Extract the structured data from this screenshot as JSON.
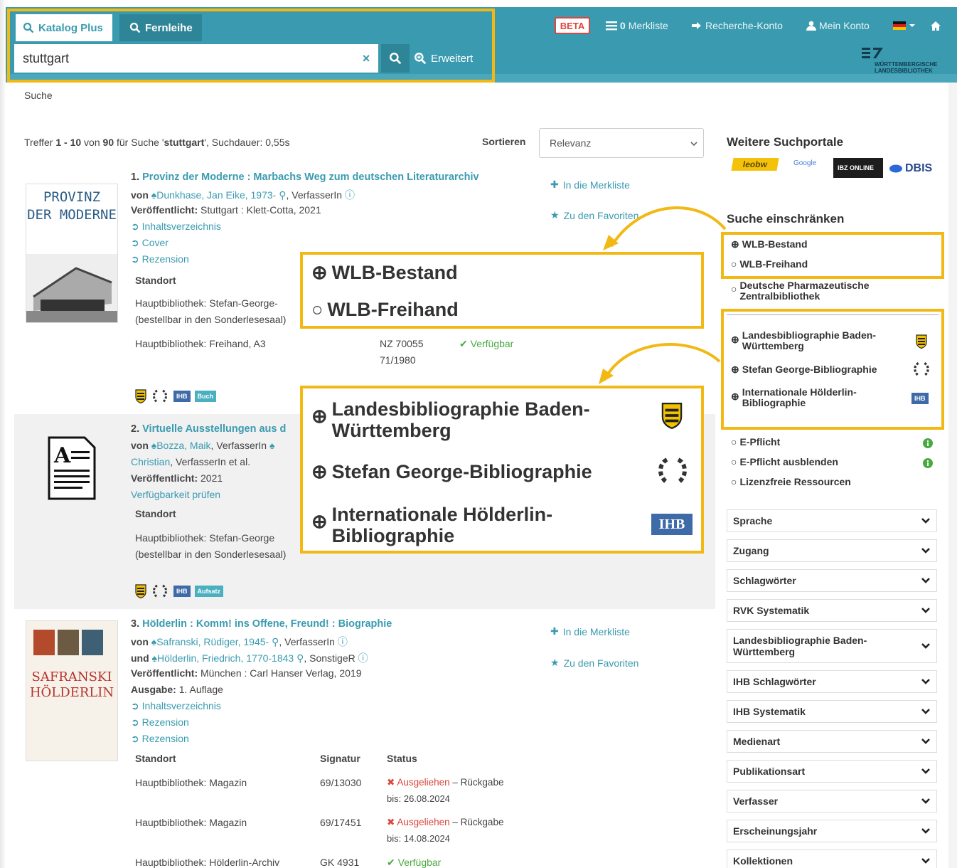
{
  "header": {
    "tab_catalog": "Katalog Plus",
    "tab_ill": "Fernleihe",
    "search_value": "stuttgart",
    "clear_label": "×",
    "advanced_label": "Erweitert",
    "beta": "BETA",
    "watchlist_count": "0",
    "watchlist": "Merkliste",
    "research_account": "Recherche-Konto",
    "my_account": "Mein Konto",
    "logo_line1": "WÜRTTEMBERGISCHE",
    "logo_line2": "LANDESBIBLIOTHEK"
  },
  "breadcrumb": "Suche",
  "results_info": {
    "prefix": "Treffer ",
    "range": "1 - 10",
    "mid": " von ",
    "total": "90",
    "for": " für Suche '",
    "query": "stuttgart",
    "suffix": "', Suchdauer: 0,55s"
  },
  "sort": {
    "label": "Sortieren",
    "value": "Relevanz"
  },
  "result_actions": {
    "add_watchlist": "In die Merkliste",
    "add_favorites": "Zu den Favoriten"
  },
  "results": [
    {
      "num": "1.",
      "title": "Provinz der Moderne : Marbachs Weg zum deutschen Literaturarchiv",
      "by_label": "von",
      "author": "Dunkhase, Jan Eike, 1973-",
      "author_role": ", VerfasserIn",
      "pub_label": "Veröffentlicht:",
      "published": "Stuttgart : Klett-Cotta, 2021",
      "links": [
        "Inhaltsverzeichnis",
        "Cover",
        "Rezension"
      ],
      "loc_header": "Standort",
      "locations": [
        {
          "loc": "Hauptbibliothek: Stefan-George-",
          "loc2": "(bestellbar in den Sonderlesesaal)"
        },
        {
          "loc": "Hauptbibliothek: Freihand, A3",
          "sig": "NZ 70055",
          "sig2": "71/1980",
          "status": "Verfügbar"
        }
      ],
      "badge_ihb": "IHB",
      "badge_type": "Buch",
      "cover_line1": "PROVINZ",
      "cover_line2": "DER MODERNE"
    },
    {
      "num": "2.",
      "title": "Virtuelle Ausstellungen aus d",
      "by_label": "von",
      "author": "Bozza, Maik",
      "author_role": ", VerfasserIn",
      "author_cont": "Christian",
      "author_role2": ", VerfasserIn et al.",
      "pub_label": "Veröffentlicht:",
      "published": "2021",
      "availability": "Verfügbarkeit prüfen",
      "loc_header": "Standort",
      "locations": [
        {
          "loc": "Hauptbibliothek: Stefan-George",
          "loc2": "(bestellbar in den Sonderlesesaal)"
        }
      ],
      "badge_ihb": "IHB",
      "badge_type": "Aufsatz"
    },
    {
      "num": "3.",
      "title": "Hölderlin : Komm! ins Offene, Freund! : Biographie",
      "by_label": "von",
      "author": "Safranski, Rüdiger, 1945-",
      "author_role": ", VerfasserIn",
      "and_label": "und",
      "author2": "Hölderlin, Friedrich, 1770-1843",
      "author2_role": ", SonstigeR",
      "pub_label": "Veröffentlicht:",
      "published": "München : Carl Hanser Verlag, 2019",
      "ed_label": "Ausgabe:",
      "edition": "1. Auflage",
      "links": [
        "Inhaltsverzeichnis",
        "Rezension",
        "Rezension"
      ],
      "loc_header": "Standort",
      "sig_header": "Signatur",
      "status_header": "Status",
      "locations": [
        {
          "loc": "Hauptbibliothek: Magazin",
          "sig": "69/13030",
          "status": "Ausgeliehen",
          "return": "– Rückgabe",
          "return2": "bis: 26.08.2024"
        },
        {
          "loc": "Hauptbibliothek: Magazin",
          "sig": "69/17451",
          "status": "Ausgeliehen",
          "return": "– Rückgabe",
          "return2": "bis: 14.08.2024"
        },
        {
          "loc": "Hauptbibliothek: Hölderlin-Archiv",
          "sig": "GK 4931",
          "status": "Verfügbar"
        }
      ],
      "cover_line1": "SAFRANSKI",
      "cover_line2": "HÖLDERLIN"
    }
  ],
  "sidebar": {
    "portals_heading": "Weitere Suchportale",
    "portals": [
      "leobw",
      "Google",
      "IBZ ONLINE",
      "DBIS"
    ],
    "restrict_heading": "Suche einschränken",
    "facets_holdings": [
      "WLB-Bestand",
      "WLB-Freihand"
    ],
    "facet_pharma": "Deutsche Pharmazeutische Zentralbibliothek",
    "facets_biblio": [
      "Landesbibliographie Baden-Württemberg",
      "Stefan George-Bibliographie",
      "Internationale Hölderlin-Bibliographie"
    ],
    "ihb_badge": "IHB",
    "facets_other": [
      "E-Pflicht",
      "E-Pflicht ausblenden",
      "Lizenzfreie Ressourcen"
    ],
    "accordions": [
      "Sprache",
      "Zugang",
      "Schlagwörter",
      "RVK Systematik",
      "Landesbibliographie Baden-Württemberg",
      "IHB Schlagwörter",
      "IHB Systematik",
      "Medienart",
      "Publikationsart",
      "Verfasser",
      "Erscheinungsjahr",
      "Kollektionen"
    ]
  },
  "zoom_callouts": {
    "holdings": [
      "WLB-Bestand",
      "WLB-Freihand"
    ],
    "bibliographies": [
      "Landesbibliographie Baden-Württemberg",
      "Stefan George-Bibliographie",
      "Internationale Hölderlin-Bibliographie"
    ],
    "ihb_badge": "IHB"
  },
  "colors": {
    "teal": "#3a9bb0",
    "highlight": "#f2b813",
    "ok": "#4aaa42",
    "bad": "#d9463c"
  }
}
